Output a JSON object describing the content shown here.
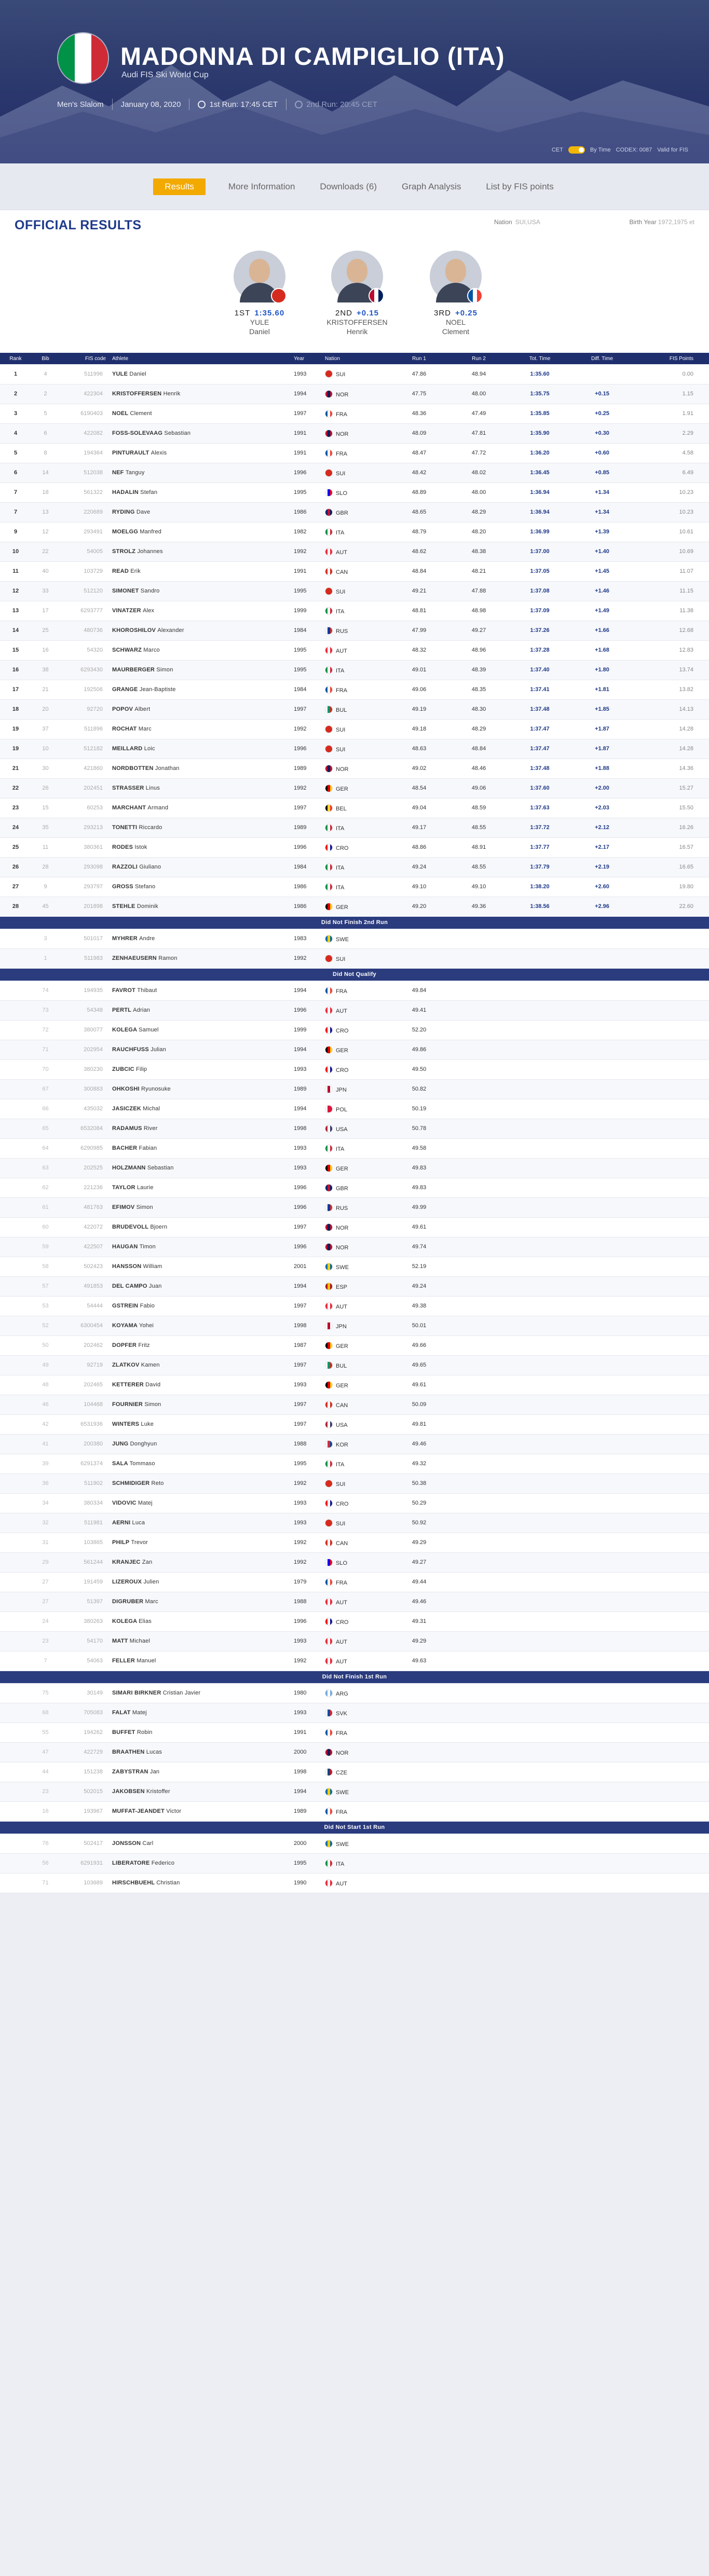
{
  "event": {
    "title": "MADONNA DI CAMPIGLIO (ITA)",
    "subtitle": "Audi FIS Ski World Cup",
    "discipline": "Men's Slalom",
    "date": "January 08, 2020",
    "run1": "1st Run: 17:45 CET",
    "run2": "2nd Run: 20:45 CET",
    "cet_label": "CET",
    "by_time_label": "By Time",
    "codex": "CODEX: 0087",
    "valid": "Valid for FIS"
  },
  "tabs": [
    "Results",
    "More Information",
    "Downloads (6)",
    "Graph Analysis",
    "List by FIS points"
  ],
  "results_header": {
    "title": "OFFICIAL RESULTS",
    "nation_label": "Nation",
    "nation_value": "SUI,USA",
    "by_label": "Birth Year",
    "by_value": "1972,1975 et"
  },
  "podium": [
    {
      "rank": "1ST",
      "value": "1:35.60",
      "first": "YULE",
      "last": "Daniel",
      "flag": [
        "#d52b1e"
      ]
    },
    {
      "rank": "2ND",
      "value": "+0.15",
      "first": "KRISTOFFERSEN",
      "last": "Henrik",
      "flag": [
        "#ba0c2f",
        "#ffffff",
        "#00205b"
      ]
    },
    {
      "rank": "3RD",
      "value": "+0.25",
      "first": "NOEL",
      "last": "Clement",
      "flag": [
        "#0055a4",
        "#ffffff",
        "#ef4135"
      ]
    }
  ],
  "columns": [
    "Rank",
    "Bib",
    "FIS code",
    "Athlete",
    "Year",
    "Nation",
    "Run 1",
    "Run 2",
    "Tot. Time",
    "Diff. Time",
    "FIS Points"
  ],
  "nations": {
    "SUI": [
      "#d52b1e",
      "#d52b1e",
      "#d52b1e"
    ],
    "NOR": [
      "#ba0c2f",
      "#00205b",
      "#ba0c2f"
    ],
    "FRA": [
      "#0055a4",
      "#ffffff",
      "#ef4135"
    ],
    "ITA": [
      "#009246",
      "#ffffff",
      "#ce2b37"
    ],
    "GBR": [
      "#012169",
      "#c8102e",
      "#012169"
    ],
    "AUT": [
      "#ed2939",
      "#ffffff",
      "#ed2939"
    ],
    "CAN": [
      "#d52b1e",
      "#ffffff",
      "#d52b1e"
    ],
    "RUS": [
      "#ffffff",
      "#0039a6",
      "#d52b1e"
    ],
    "GER": [
      "#000000",
      "#dd0000",
      "#ffce00"
    ],
    "BUL": [
      "#ffffff",
      "#00966e",
      "#d62612"
    ],
    "CRO": [
      "#ff0000",
      "#ffffff",
      "#171796"
    ],
    "BEL": [
      "#000000",
      "#fdda24",
      "#ef3340"
    ],
    "SWE": [
      "#006aa7",
      "#fecc00",
      "#006aa7"
    ],
    "JPN": [
      "#ffffff",
      "#bc002d",
      "#ffffff"
    ],
    "POL": [
      "#ffffff",
      "#dc143c",
      "#dc143c"
    ],
    "USA": [
      "#b22234",
      "#ffffff",
      "#3c3b6e"
    ],
    "ESP": [
      "#aa151b",
      "#f1bf00",
      "#aa151b"
    ],
    "KOR": [
      "#ffffff",
      "#cd2e3a",
      "#0047a0"
    ],
    "SLO": [
      "#ffffff",
      "#0000ff",
      "#ff0000"
    ],
    "ARG": [
      "#74acdf",
      "#ffffff",
      "#74acdf"
    ],
    "SVK": [
      "#ffffff",
      "#0b4ea2",
      "#ee1c25"
    ],
    "CZE": [
      "#ffffff",
      "#11457e",
      "#d7141a"
    ]
  },
  "results": [
    [
      "1",
      "4",
      "511996",
      "YULE",
      "Daniel",
      "1993",
      "SUI",
      "47.86",
      "48.94",
      "1:35.60",
      "",
      "0.00"
    ],
    [
      "2",
      "2",
      "422304",
      "KRISTOFFERSEN",
      "Henrik",
      "1994",
      "NOR",
      "47.75",
      "48.00",
      "1:35.75",
      "+0.15",
      "1.15"
    ],
    [
      "3",
      "5",
      "6190403",
      "NOEL",
      "Clement",
      "1997",
      "FRA",
      "48.36",
      "47.49",
      "1:35.85",
      "+0.25",
      "1.91"
    ],
    [
      "4",
      "6",
      "422082",
      "FOSS-SOLEVAAG",
      "Sebastian",
      "1991",
      "NOR",
      "48.09",
      "47.81",
      "1:35.90",
      "+0.30",
      "2.29"
    ],
    [
      "5",
      "8",
      "194364",
      "PINTURAULT",
      "Alexis",
      "1991",
      "FRA",
      "48.47",
      "47.72",
      "1:36.20",
      "+0.60",
      "4.58"
    ],
    [
      "6",
      "14",
      "512038",
      "NEF",
      "Tanguy",
      "1996",
      "SUI",
      "48.42",
      "48.02",
      "1:36.45",
      "+0.85",
      "6.49"
    ],
    [
      "7",
      "18",
      "561322",
      "HADALIN",
      "Stefan",
      "1995",
      "SLO",
      "48.89",
      "48.00",
      "1:36.94",
      "+1.34",
      "10.23"
    ],
    [
      "7",
      "13",
      "220689",
      "RYDING",
      "Dave",
      "1986",
      "GBR",
      "48.65",
      "48.29",
      "1:36.94",
      "+1.34",
      "10.23"
    ],
    [
      "9",
      "12",
      "293491",
      "MOELGG",
      "Manfred",
      "1982",
      "ITA",
      "48.79",
      "48.20",
      "1:36.99",
      "+1.39",
      "10.61"
    ],
    [
      "10",
      "22",
      "54005",
      "STROLZ",
      "Johannes",
      "1992",
      "AUT",
      "48.62",
      "48.38",
      "1:37.00",
      "+1.40",
      "10.69"
    ],
    [
      "11",
      "40",
      "103729",
      "READ",
      "Erik",
      "1991",
      "CAN",
      "48.84",
      "48.21",
      "1:37.05",
      "+1.45",
      "11.07"
    ],
    [
      "12",
      "33",
      "512120",
      "SIMONET",
      "Sandro",
      "1995",
      "SUI",
      "49.21",
      "47.88",
      "1:37.08",
      "+1.46",
      "11.15"
    ],
    [
      "13",
      "17",
      "6293777",
      "VINATZER",
      "Alex",
      "1999",
      "ITA",
      "48.81",
      "48.98",
      "1:37.09",
      "+1.49",
      "11.38"
    ],
    [
      "14",
      "25",
      "480736",
      "KHOROSHILOV",
      "Alexander",
      "1984",
      "RUS",
      "47.99",
      "49.27",
      "1:37.26",
      "+1.66",
      "12.68"
    ],
    [
      "15",
      "16",
      "54320",
      "SCHWARZ",
      "Marco",
      "1995",
      "AUT",
      "48.32",
      "48.96",
      "1:37.28",
      "+1.68",
      "12.83"
    ],
    [
      "16",
      "38",
      "6293430",
      "MAURBERGER",
      "Simon",
      "1995",
      "ITA",
      "49.01",
      "48.39",
      "1:37.40",
      "+1.80",
      "13.74"
    ],
    [
      "17",
      "21",
      "192506",
      "GRANGE",
      "Jean-Baptiste",
      "1984",
      "FRA",
      "49.06",
      "48.35",
      "1:37.41",
      "+1.81",
      "13.82"
    ],
    [
      "18",
      "20",
      "92720",
      "POPOV",
      "Albert",
      "1997",
      "BUL",
      "49.19",
      "48.30",
      "1:37.48",
      "+1.85",
      "14.13"
    ],
    [
      "19",
      "37",
      "511896",
      "ROCHAT",
      "Marc",
      "1992",
      "SUI",
      "49.18",
      "48.29",
      "1:37.47",
      "+1.87",
      "14.28"
    ],
    [
      "19",
      "10",
      "512182",
      "MEILLARD",
      "Loic",
      "1996",
      "SUI",
      "48.63",
      "48.84",
      "1:37.47",
      "+1.87",
      "14.28"
    ],
    [
      "21",
      "30",
      "421860",
      "NORDBOTTEN",
      "Jonathan",
      "1989",
      "NOR",
      "49.02",
      "48.46",
      "1:37.48",
      "+1.88",
      "14.36"
    ],
    [
      "22",
      "26",
      "202451",
      "STRASSER",
      "Linus",
      "1992",
      "GER",
      "48.54",
      "49.06",
      "1:37.60",
      "+2.00",
      "15.27"
    ],
    [
      "23",
      "15",
      "60253",
      "MARCHANT",
      "Armand",
      "1997",
      "BEL",
      "49.04",
      "48.59",
      "1:37.63",
      "+2.03",
      "15.50"
    ],
    [
      "24",
      "35",
      "293213",
      "TONETTI",
      "Riccardo",
      "1989",
      "ITA",
      "49.17",
      "48.55",
      "1:37.72",
      "+2.12",
      "16.26"
    ],
    [
      "25",
      "11",
      "380361",
      "RODES",
      "Istok",
      "1996",
      "CRO",
      "48.86",
      "48.91",
      "1:37.77",
      "+2.17",
      "16.57"
    ],
    [
      "26",
      "28",
      "293098",
      "RAZZOLI",
      "Giuliano",
      "1984",
      "ITA",
      "49.24",
      "48.55",
      "1:37.79",
      "+2.19",
      "16.65"
    ],
    [
      "27",
      "9",
      "293797",
      "GROSS",
      "Stefano",
      "1986",
      "ITA",
      "49.10",
      "49.10",
      "1:38.20",
      "+2.60",
      "19.80"
    ],
    [
      "28",
      "45",
      "201898",
      "STEHLE",
      "Dominik",
      "1986",
      "GER",
      "49.20",
      "49.36",
      "1:38.56",
      "+2.96",
      "22.60"
    ]
  ],
  "dnf2_label": "Did Not Finish 2nd Run",
  "dnf2": [
    [
      "3",
      "501017",
      "MYHRER",
      "Andre",
      "1983",
      "SWE"
    ],
    [
      "1",
      "511983",
      "ZENHAEUSERN",
      "Ramon",
      "1992",
      "SUI"
    ]
  ],
  "dnq_label": "Did Not Qualify",
  "dnq": [
    [
      "74",
      "194935",
      "FAVROT",
      "Thibaut",
      "1994",
      "FRA",
      "49.84"
    ],
    [
      "73",
      "54348",
      "PERTL",
      "Adrian",
      "1996",
      "AUT",
      "49.41"
    ],
    [
      "72",
      "380077",
      "KOLEGA",
      "Samuel",
      "1999",
      "CRO",
      "52.20"
    ],
    [
      "71",
      "202954",
      "RAUCHFUSS",
      "Julian",
      "1994",
      "GER",
      "49.86"
    ],
    [
      "70",
      "380230",
      "ZUBCIC",
      "Filip",
      "1993",
      "CRO",
      "49.50"
    ],
    [
      "67",
      "300883",
      "OHKOSHI",
      "Ryunosuke",
      "1989",
      "JPN",
      "50.82"
    ],
    [
      "66",
      "435032",
      "JASICZEK",
      "Michal",
      "1994",
      "POL",
      "50.19"
    ],
    [
      "65",
      "6532084",
      "RADAMUS",
      "River",
      "1998",
      "USA",
      "50.78"
    ],
    [
      "64",
      "6290985",
      "BACHER",
      "Fabian",
      "1993",
      "ITA",
      "49.58"
    ],
    [
      "63",
      "202525",
      "HOLZMANN",
      "Sebastian",
      "1993",
      "GER",
      "49.83"
    ],
    [
      "62",
      "221236",
      "TAYLOR",
      "Laurie",
      "1996",
      "GBR",
      "49.83"
    ],
    [
      "61",
      "481763",
      "EFIMOV",
      "Simon",
      "1996",
      "RUS",
      "49.99"
    ],
    [
      "60",
      "422072",
      "BRUDEVOLL",
      "Bjoern",
      "1997",
      "NOR",
      "49.61"
    ],
    [
      "59",
      "422507",
      "HAUGAN",
      "Timon",
      "1996",
      "NOR",
      "49.74"
    ],
    [
      "58",
      "502423",
      "HANSSON",
      "William",
      "2001",
      "SWE",
      "52.19"
    ],
    [
      "57",
      "491853",
      "DEL CAMPO",
      "Juan",
      "1994",
      "ESP",
      "49.24"
    ],
    [
      "53",
      "54444",
      "GSTREIN",
      "Fabio",
      "1997",
      "AUT",
      "49.38"
    ],
    [
      "52",
      "6300454",
      "KOYAMA",
      "Yohei",
      "1998",
      "JPN",
      "50.01"
    ],
    [
      "50",
      "202462",
      "DOPFER",
      "Fritz",
      "1987",
      "GER",
      "49.66"
    ],
    [
      "49",
      "92719",
      "ZLATKOV",
      "Kamen",
      "1997",
      "BUL",
      "49.65"
    ],
    [
      "48",
      "202465",
      "KETTERER",
      "David",
      "1993",
      "GER",
      "49.61"
    ],
    [
      "46",
      "104468",
      "FOURNIER",
      "Simon",
      "1997",
      "CAN",
      "50.09"
    ],
    [
      "42",
      "6531936",
      "WINTERS",
      "Luke",
      "1997",
      "USA",
      "49.81"
    ],
    [
      "41",
      "200380",
      "JUNG",
      "Donghyun",
      "1988",
      "KOR",
      "49.46"
    ],
    [
      "39",
      "6291374",
      "SALA",
      "Tommaso",
      "1995",
      "ITA",
      "49.32"
    ],
    [
      "36",
      "511902",
      "SCHMIDIGER",
      "Reto",
      "1992",
      "SUI",
      "50.38"
    ],
    [
      "34",
      "380334",
      "VIDOVIC",
      "Matej",
      "1993",
      "CRO",
      "50.29"
    ],
    [
      "32",
      "511981",
      "AERNI",
      "Luca",
      "1993",
      "SUI",
      "50.92"
    ],
    [
      "31",
      "103865",
      "PHILP",
      "Trevor",
      "1992",
      "CAN",
      "49.29"
    ],
    [
      "29",
      "561244",
      "KRANJEC",
      "Zan",
      "1992",
      "SLO",
      "49.27"
    ],
    [
      "27",
      "191459",
      "LIZEROUX",
      "Julien",
      "1979",
      "FRA",
      "49.44"
    ],
    [
      "27",
      "51397",
      "DIGRUBER",
      "Marc",
      "1988",
      "AUT",
      "49.46"
    ],
    [
      "24",
      "380263",
      "KOLEGA",
      "Elias",
      "1996",
      "CRO",
      "49.31"
    ],
    [
      "23",
      "54170",
      "MATT",
      "Michael",
      "1993",
      "AUT",
      "49.29"
    ],
    [
      "7",
      "54063",
      "FELLER",
      "Manuel",
      "1992",
      "AUT",
      "49.63"
    ]
  ],
  "dnf1_label": "Did Not Finish 1st Run",
  "dnf1": [
    [
      "75",
      "30149",
      "SIMARI BIRKNER",
      "Cristian Javier",
      "1980",
      "ARG"
    ],
    [
      "68",
      "705083",
      "FALAT",
      "Matej",
      "1993",
      "SVK"
    ],
    [
      "55",
      "194262",
      "BUFFET",
      "Robin",
      "1991",
      "FRA"
    ],
    [
      "47",
      "422729",
      "BRAATHEN",
      "Lucas",
      "2000",
      "NOR"
    ],
    [
      "44",
      "151238",
      "ZABYSTRAN",
      "Jan",
      "1998",
      "CZE"
    ],
    [
      "23",
      "502015",
      "JAKOBSEN",
      "Kristoffer",
      "1994",
      "SWE"
    ],
    [
      "16",
      "193967",
      "MUFFAT-JEANDET",
      "Victor",
      "1989",
      "FRA"
    ]
  ],
  "dns1_label": "Did Not Start 1st Run",
  "dns1": [
    [
      "76",
      "502417",
      "JONSSON",
      "Carl",
      "2000",
      "SWE"
    ],
    [
      "56",
      "6291931",
      "LIBERATORE",
      "Federico",
      "1995",
      "ITA"
    ],
    [
      "71",
      "103689",
      "HIRSCHBUEHL",
      "Christian",
      "1990",
      "AUT"
    ]
  ]
}
